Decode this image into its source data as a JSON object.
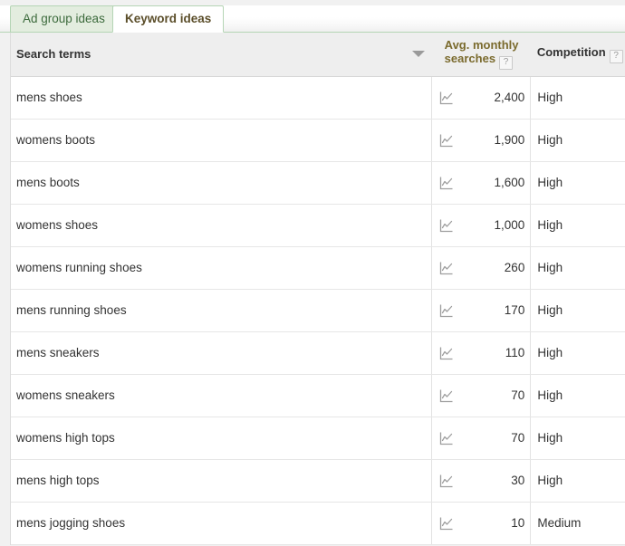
{
  "tabs": [
    {
      "label": "Ad group ideas",
      "active": false
    },
    {
      "label": "Keyword ideas",
      "active": true
    }
  ],
  "table": {
    "columns": {
      "search_terms": "Search terms",
      "avg_monthly_line1": "Avg. monthly",
      "avg_monthly_line2": "searches",
      "competition": "Competition",
      "help_glyph": "?"
    },
    "sort": {
      "column": "Avg. monthly searches",
      "direction": "descending",
      "arrow_icon": "sort-descending-arrow-icon"
    },
    "row_icon": "search-volume-trend-chart-icon",
    "rows": [
      {
        "term": "mens shoes",
        "avg_monthly_searches": "2,400",
        "competition": "High"
      },
      {
        "term": "womens boots",
        "avg_monthly_searches": "1,900",
        "competition": "High"
      },
      {
        "term": "mens boots",
        "avg_monthly_searches": "1,600",
        "competition": "High"
      },
      {
        "term": "womens shoes",
        "avg_monthly_searches": "1,000",
        "competition": "High"
      },
      {
        "term": "womens running shoes",
        "avg_monthly_searches": "260",
        "competition": "High"
      },
      {
        "term": "mens running shoes",
        "avg_monthly_searches": "170",
        "competition": "High"
      },
      {
        "term": "mens sneakers",
        "avg_monthly_searches": "110",
        "competition": "High"
      },
      {
        "term": "womens sneakers",
        "avg_monthly_searches": "70",
        "competition": "High"
      },
      {
        "term": "womens high tops",
        "avg_monthly_searches": "70",
        "competition": "High"
      },
      {
        "term": "mens high tops",
        "avg_monthly_searches": "30",
        "competition": "High"
      },
      {
        "term": "mens jogging shoes",
        "avg_monthly_searches": "10",
        "competition": "Medium"
      }
    ]
  },
  "colors": {
    "tab_active_text": "#5b4e2a",
    "tab_inactive_bg": "#e3eddf",
    "tab_border_green": "#b5d5b5",
    "sorted_column_header_text": "#7a6a2d",
    "page_bg": "#f1f1f1",
    "header_row_bg": "#eeeeee"
  }
}
